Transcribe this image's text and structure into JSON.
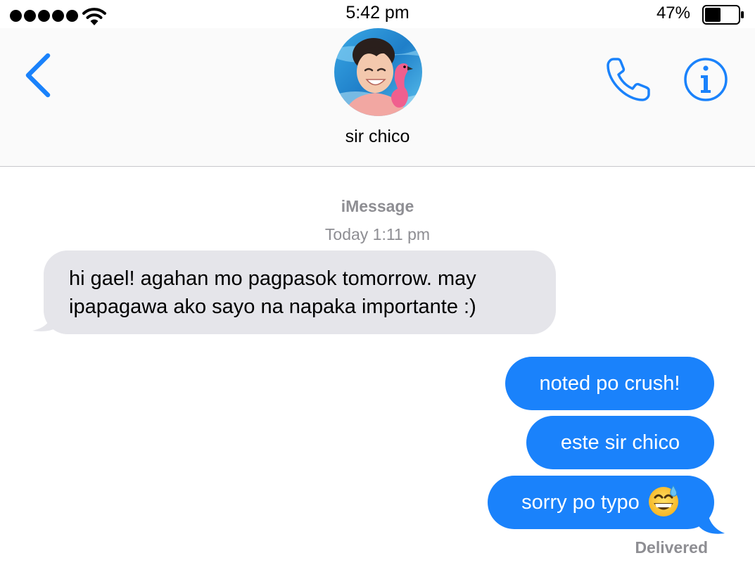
{
  "status_bar": {
    "time": "5:42 pm",
    "battery_percent": "47%",
    "battery_level": 0.47,
    "signal_bars": 5
  },
  "header": {
    "contact_name": "sir chico",
    "back_icon": "chevron-left-icon",
    "call_icon": "phone-icon",
    "info_icon": "info-icon",
    "accent_color": "#1a82fb"
  },
  "conversation": {
    "service": "iMessage",
    "timestamp": "Today 1:11 pm",
    "messages": [
      {
        "direction": "incoming",
        "text": "hi gael! agahan mo pagpasok tomorrow. may ipapagawa ako sayo na napaka importante :)"
      },
      {
        "direction": "outgoing",
        "text": "noted po crush!"
      },
      {
        "direction": "outgoing",
        "text": "este sir chico"
      },
      {
        "direction": "outgoing",
        "text": "sorry po typo",
        "emoji": "grinning-face-with-sweat"
      }
    ],
    "delivery_status": "Delivered",
    "incoming_bubble_color": "#e5e5ea",
    "outgoing_bubble_color": "#1a82fb"
  }
}
